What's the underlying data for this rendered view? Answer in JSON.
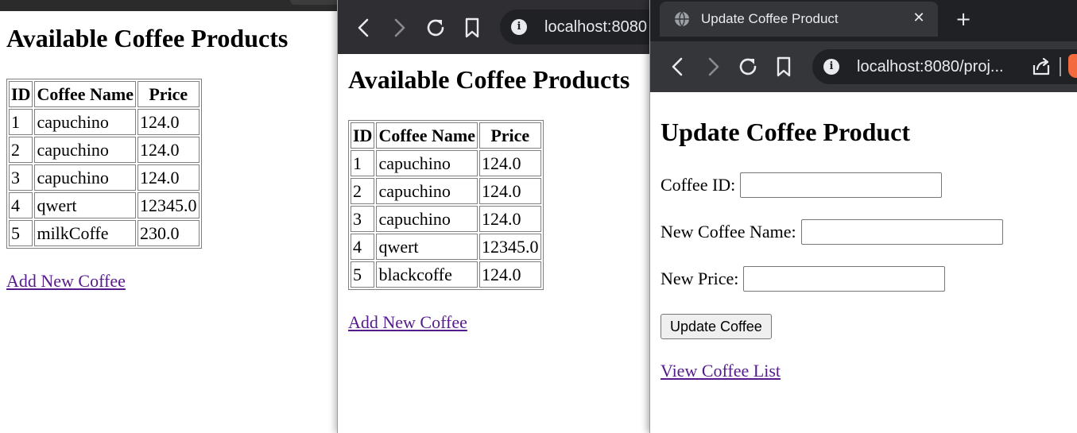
{
  "colors": {
    "toolbar_bg": "#2e2e33",
    "tabbar_bg": "#202124",
    "link": "#551a8b"
  },
  "window1": {
    "heading": "Available Coffee Products",
    "table": {
      "headers": [
        "ID",
        "Coffee Name",
        "Price"
      ],
      "rows": [
        [
          "1",
          "capuchino",
          "124.0"
        ],
        [
          "2",
          "capuchino",
          "124.0"
        ],
        [
          "3",
          "capuchino",
          "124.0"
        ],
        [
          "4",
          "qwert",
          "12345.0"
        ],
        [
          "5",
          "milkCoffe",
          "230.0"
        ]
      ]
    },
    "add_link": "Add New Coffee"
  },
  "window2": {
    "url": "localhost:8080",
    "heading": "Available Coffee Products",
    "table": {
      "headers": [
        "ID",
        "Coffee Name",
        "Price"
      ],
      "rows": [
        [
          "1",
          "capuchino",
          "124.0"
        ],
        [
          "2",
          "capuchino",
          "124.0"
        ],
        [
          "3",
          "capuchino",
          "124.0"
        ],
        [
          "4",
          "qwert",
          "12345.0"
        ],
        [
          "5",
          "blackcoffe",
          "124.0"
        ]
      ]
    },
    "add_link": "Add New Coffee"
  },
  "window3": {
    "tab_title": "Update Coffee Product",
    "tab_close": "✕",
    "new_tab": "+",
    "url": "localhost:8080/proj...",
    "heading": "Update Coffee Product",
    "form": {
      "id_label": "Coffee ID:",
      "name_label": "New Coffee Name:",
      "price_label": "New Price:",
      "id_value": "",
      "name_value": "",
      "price_value": ""
    },
    "submit_label": "Update Coffee",
    "view_link": "View Coffee List"
  },
  "icons": {
    "back": "chevron-left-icon",
    "forward": "chevron-right-icon",
    "reload": "reload-icon",
    "bookmark": "bookmark-icon",
    "info": "info-icon",
    "globe": "globe-icon",
    "share": "share-icon"
  }
}
